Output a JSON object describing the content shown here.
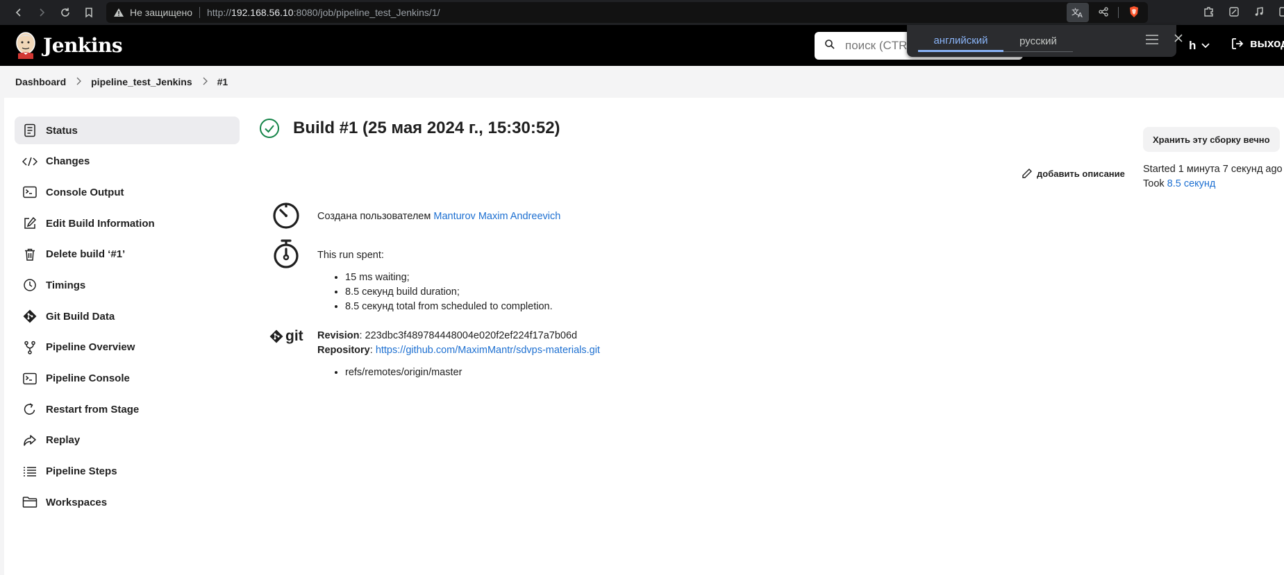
{
  "browser": {
    "not_secure": "Не защищено",
    "url_prefix": "http://",
    "url_host": "192.168.56.10",
    "url_rest": ":8080/job/pipeline_test_Jenkins/1/"
  },
  "header": {
    "brand": "Jenkins",
    "search_placeholder": "поиск (CTRL+K)",
    "user_fragment": "h",
    "logout_label": "выход"
  },
  "translate_popup": {
    "tab_active": "английский",
    "tab_inactive": "русский"
  },
  "breadcrumb": {
    "items": [
      "Dashboard",
      "pipeline_test_Jenkins",
      "#1"
    ]
  },
  "sidebar": {
    "items": [
      {
        "label": "Status",
        "icon": "status-icon"
      },
      {
        "label": "Changes",
        "icon": "code-icon"
      },
      {
        "label": "Console Output",
        "icon": "terminal-icon"
      },
      {
        "label": "Edit Build Information",
        "icon": "edit-icon"
      },
      {
        "label": "Delete build ‘#1’",
        "icon": "trash-icon"
      },
      {
        "label": "Timings",
        "icon": "clock-icon"
      },
      {
        "label": "Git Build Data",
        "icon": "git-icon"
      },
      {
        "label": "Pipeline Overview",
        "icon": "branch-icon"
      },
      {
        "label": "Pipeline Console",
        "icon": "terminal-icon"
      },
      {
        "label": "Restart from Stage",
        "icon": "restart-icon"
      },
      {
        "label": "Replay",
        "icon": "replay-icon"
      },
      {
        "label": "Pipeline Steps",
        "icon": "list-icon"
      },
      {
        "label": "Workspaces",
        "icon": "folder-icon"
      }
    ]
  },
  "main": {
    "title": "Build #1 (25 мая 2024 г., 15:30:52)",
    "keep_button": "Хранить эту сборку вечно",
    "add_description": "добавить описание",
    "started_label": "Started 1 минута 7 секунд ago",
    "took_prefix": "Took ",
    "took_value": "8.5 секунд",
    "created_by_prefix": "Создана пользователем ",
    "created_by_user": "Manturov Maxim Andreevich",
    "run_spent": "This run spent:",
    "run_items": [
      "15 ms waiting;",
      "8.5 секунд build duration;",
      "8.5 секунд total from scheduled to completion."
    ],
    "git_logo": "git",
    "revision_label": "Revision",
    "revision_value": "223dbc3f489784448004e020f2ef224f17a7b06d",
    "repository_label": "Repository",
    "repository_url": "https://github.com/MaximMantr/sdvps-materials.git",
    "refs": [
      "refs/remotes/origin/master"
    ]
  },
  "colors": {
    "success": "#138347",
    "link": "#1c6fd1",
    "header_bg": "#000000"
  }
}
